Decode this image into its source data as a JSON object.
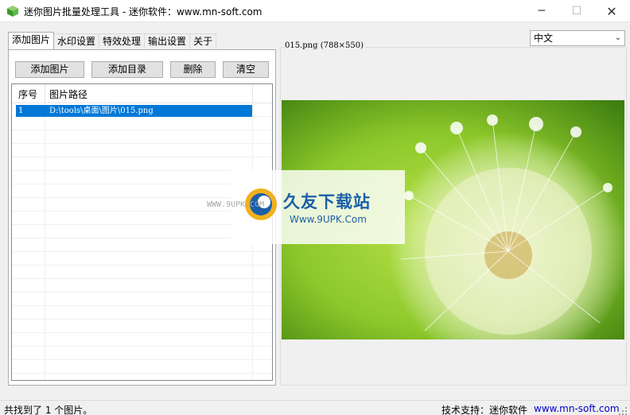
{
  "window": {
    "title": "迷你图片批量处理工具 - 迷你软件：www.mn-soft.com",
    "minimize": "─",
    "maximize": "☐",
    "close": "✕"
  },
  "tabs": [
    {
      "label": "添加图片",
      "active": true
    },
    {
      "label": "水印设置",
      "active": false
    },
    {
      "label": "特效处理",
      "active": false
    },
    {
      "label": "输出设置",
      "active": false
    },
    {
      "label": "关于",
      "active": false
    }
  ],
  "toolbar": {
    "add_image": "添加图片",
    "add_dir": "添加目录",
    "delete": "删除",
    "clear": "清空"
  },
  "list": {
    "columns": [
      "序号",
      "图片路径"
    ],
    "rows": [
      {
        "num": "1",
        "path": "D:\\tools\\桌面\\图片\\015.png",
        "selected": true
      }
    ]
  },
  "language": {
    "selected": "中文"
  },
  "preview": {
    "label": "015.png (788×550)"
  },
  "watermark": {
    "brand": "久友下载站",
    "url_big": "Www.9UPK.Com",
    "url_small": "WWW.9UPK.COM"
  },
  "status": {
    "left": "共找到了 1 个图片。",
    "support_label": "技术支持：迷你软件",
    "support_link": "www.mn-soft.com"
  },
  "colors": {
    "selection": "#0078d7",
    "link": "#0000cc",
    "watermark_blue": "#1a5fa8"
  }
}
